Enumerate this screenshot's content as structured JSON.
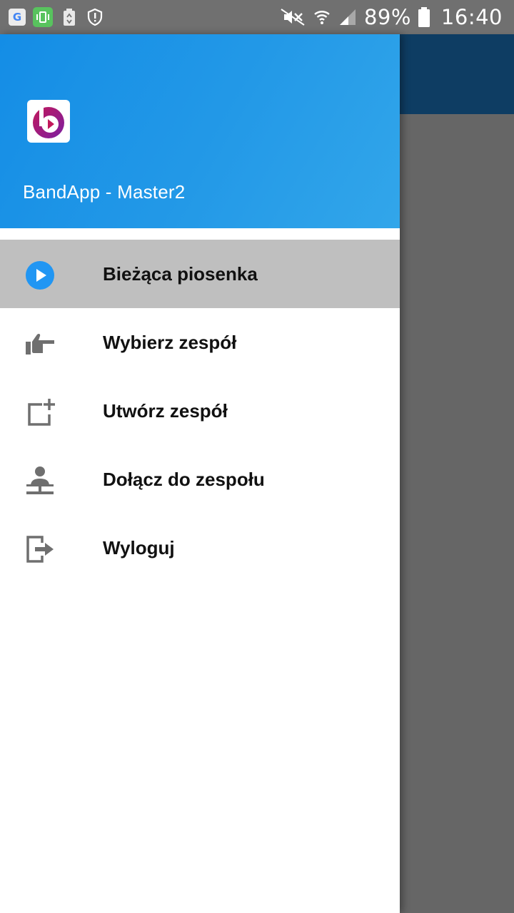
{
  "status_bar": {
    "battery_text": "89%",
    "time": "16:40",
    "icons": [
      "google-icon",
      "screen-capture-icon",
      "battery-saver-icon",
      "shield-icon",
      "mute-icon",
      "wifi-icon",
      "signal-icon",
      "battery-icon"
    ]
  },
  "drawer": {
    "header": {
      "app_name": "BandApp - Master2",
      "logo_icon": "bandapp-logo-icon"
    },
    "menu": [
      {
        "label": "Bieżąca piosenka",
        "icon": "play-circle-icon",
        "selected": true
      },
      {
        "label": "Wybierz zespół",
        "icon": "thumb-point-icon",
        "selected": false
      },
      {
        "label": "Utwórz zespół",
        "icon": "add-box-icon",
        "selected": false
      },
      {
        "label": "Dołącz do zespołu",
        "icon": "person-join-icon",
        "selected": false
      },
      {
        "label": "Wyloguj",
        "icon": "logout-icon",
        "selected": false
      }
    ]
  },
  "colors": {
    "header_gradient_start": "#148de6",
    "header_gradient_end": "#32a6ea",
    "selected_item_bg": "#bfbfbf",
    "accent_icon": "#2196f3",
    "toolbar_behind": "#0e3d63",
    "scrim": "#666666",
    "status_bar": "#707070"
  }
}
